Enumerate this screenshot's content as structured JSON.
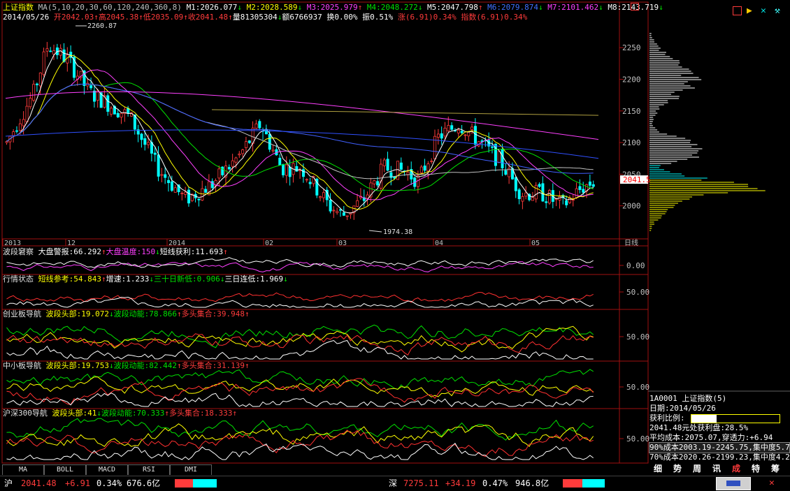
{
  "header": {
    "index_name": "上证指数",
    "ma_label": "MA(5,10,20,30,60,120,240,360,8)",
    "m1": "M1:2026.077",
    "m2": "M2:2028.589",
    "m3": "M3:2025.979",
    "m4": "M4:2048.272",
    "m5": "M5:2047.798",
    "m6": "M6:2079.874",
    "m7": "M7:2101.462",
    "m8": "M8:2143.719",
    "date": "2014/05/26",
    "open": "开2042.03",
    "high": "高2045.38",
    "low": "低2035.09",
    "close": "收2041.48",
    "volume": "量81305304",
    "amount": "额6766937",
    "turnover": "换0.00%",
    "amplitude": "振0.51%",
    "change": "涨(6.91)0.34%",
    "index_change": "指数(6.91)0.34%"
  },
  "chart_data": {
    "type": "candlestick",
    "y_axis": {
      "min": 1950,
      "max": 2290,
      "ticks": [
        2000,
        2050,
        2100,
        2150,
        2200,
        2250
      ]
    },
    "x_labels": [
      "2013",
      "12",
      "2014",
      "02",
      "03",
      "04",
      "05",
      "日线"
    ],
    "annotations": {
      "high": "2260.87",
      "low": "1974.38",
      "current": "2041.5"
    },
    "current_price": 2041.5,
    "high_value": 2260.87,
    "low_value": 1974.38
  },
  "panels": [
    {
      "title": "波段窘察",
      "items": [
        {
          "t": "大盘警报:66.292",
          "c": "wht"
        },
        {
          "t": "↑",
          "c": "red"
        },
        {
          "t": "大盘温度:150",
          "c": "mag"
        },
        {
          "t": "↓",
          "c": "grn"
        },
        {
          "t": "短线获利:11.693",
          "c": "wht"
        },
        {
          "t": "↑",
          "c": "red"
        }
      ],
      "ref": "0.00"
    },
    {
      "title": "行情状态",
      "items": [
        {
          "t": "短线参考:54.843",
          "c": "yel"
        },
        {
          "t": "↑",
          "c": "red"
        },
        {
          "t": "增速:1.233",
          "c": "wht"
        },
        {
          "t": "↓",
          "c": "grn"
        },
        {
          "t": "三十日新低:0.906",
          "c": "grn"
        },
        {
          "t": "↓",
          "c": "grn"
        },
        {
          "t": "三日连低:1.969",
          "c": "wht"
        },
        {
          "t": "↓",
          "c": "grn"
        }
      ],
      "ref": "50.00"
    },
    {
      "title": "创业板导航",
      "items": [
        {
          "t": "波段头部:19.072",
          "c": "yel"
        },
        {
          "t": "↓",
          "c": "grn"
        },
        {
          "t": "波段动能:78.866",
          "c": "grn"
        },
        {
          "t": "↑",
          "c": "red"
        },
        {
          "t": "多头集合:39.948",
          "c": "red"
        },
        {
          "t": "↑",
          "c": "red"
        }
      ],
      "ref": "50.00"
    },
    {
      "title": "中小板导航",
      "items": [
        {
          "t": "波段头部:19.753",
          "c": "yel"
        },
        {
          "t": "↓",
          "c": "grn"
        },
        {
          "t": "波段动能:82.442",
          "c": "grn"
        },
        {
          "t": "↑",
          "c": "red"
        },
        {
          "t": "多头集合:31.139",
          "c": "red"
        },
        {
          "t": "↑",
          "c": "red"
        }
      ],
      "ref": "50.00"
    },
    {
      "title": "沪深300导航",
      "items": [
        {
          "t": "波段头部:41",
          "c": "yel"
        },
        {
          "t": "↓",
          "c": "grn"
        },
        {
          "t": "波段动能:70.333",
          "c": "grn"
        },
        {
          "t": "↑",
          "c": "red"
        },
        {
          "t": "多头集合:18.333",
          "c": "red"
        },
        {
          "t": "↑",
          "c": "red"
        }
      ],
      "ref": "50.00"
    }
  ],
  "tabs": [
    "MA",
    "BOLL",
    "MACD",
    "RSI",
    "DMI"
  ],
  "right_info": {
    "code": "1A0001 上证指数(5)",
    "date": "日期:2014/05/26",
    "profit_label": "获利比例:",
    "profit_value": "28.5%",
    "profit_fraction": 0.285,
    "line1": "2041.48元处获利盘:28.5%",
    "line2": "平均成本:2075.07,穿透力:+6.94",
    "line3": "90%成本2003.19-2245.75,集中度5.7",
    "line4": "70%成本2020.26-2199.23,集中度4.2"
  },
  "bottom_tabs": [
    "细",
    "势",
    "周",
    "讯",
    "成",
    "特",
    "筹"
  ],
  "status": {
    "sh_label": "沪",
    "sh_price": "2041.48",
    "sh_change": "+6.91",
    "sh_pct": "0.34%",
    "sh_amount": "676.6亿",
    "sz_label": "深",
    "sz_price": "7275.11",
    "sz_change": "+34.19",
    "sz_pct": "0.47%",
    "sz_amount": "946.8亿"
  },
  "colors": {
    "up": "#ff3b3b",
    "down": "#00ffff",
    "grid": "#a01010",
    "yellow": "#ffff00"
  }
}
